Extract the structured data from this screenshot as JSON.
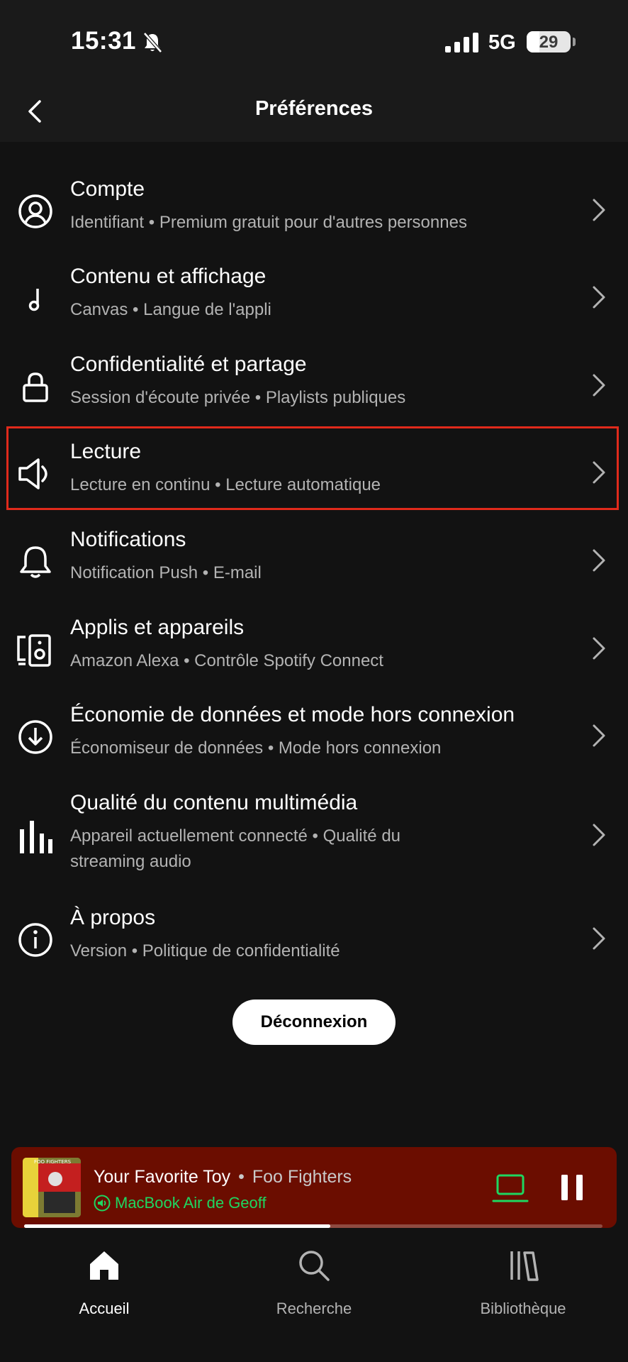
{
  "status": {
    "time": "15:31",
    "network": "5G",
    "battery": "29",
    "battery_level": 0.29
  },
  "header": {
    "title": "Préférences"
  },
  "settings": [
    {
      "title": "Compte",
      "subtitle": "Identifiant • Premium gratuit pour d'autres personnes",
      "icon": "user-circle-icon"
    },
    {
      "title": "Contenu et affichage",
      "subtitle": "Canvas • Langue de l'appli",
      "icon": "music-note-icon"
    },
    {
      "title": "Confidentialité et partage",
      "subtitle": "Session d'écoute privée • Playlists publiques",
      "icon": "lock-icon"
    },
    {
      "title": "Lecture",
      "subtitle": "Lecture en continu • Lecture automatique",
      "icon": "speaker-icon"
    },
    {
      "title": "Notifications",
      "subtitle": "Notification Push • E-mail",
      "icon": "bell-icon"
    },
    {
      "title": "Applis et appareils",
      "subtitle": "Amazon Alexa • Contrôle Spotify Connect",
      "icon": "devices-icon"
    },
    {
      "title": "Économie de données et mode hors connexion",
      "subtitle": "Économiseur de données • Mode hors connexion",
      "icon": "download-circle-icon"
    },
    {
      "title": "Qualité du contenu multimédia",
      "subtitle": "Appareil actuellement connecté • Qualité du streaming audio",
      "icon": "bars-icon"
    },
    {
      "title": "À propos",
      "subtitle": "Version • Politique de confidentialité",
      "icon": "info-icon"
    }
  ],
  "logout_label": "Déconnexion",
  "player": {
    "track": "Your Favorite Toy",
    "separator": "•",
    "artist": "Foo Fighters",
    "device": "MacBook Air de Geoff",
    "album_art_text": "FOO FIGHTERS",
    "progress": 0.53
  },
  "tabs": [
    {
      "label": "Accueil",
      "icon": "home-icon",
      "active": true
    },
    {
      "label": "Recherche",
      "icon": "search-icon",
      "active": false
    },
    {
      "label": "Bibliothèque",
      "icon": "library-icon",
      "active": false
    }
  ],
  "colors": {
    "background": "#121212",
    "accent": "#1ed760",
    "player_bg": "#6b0d00",
    "highlight": "#e02a1b"
  }
}
